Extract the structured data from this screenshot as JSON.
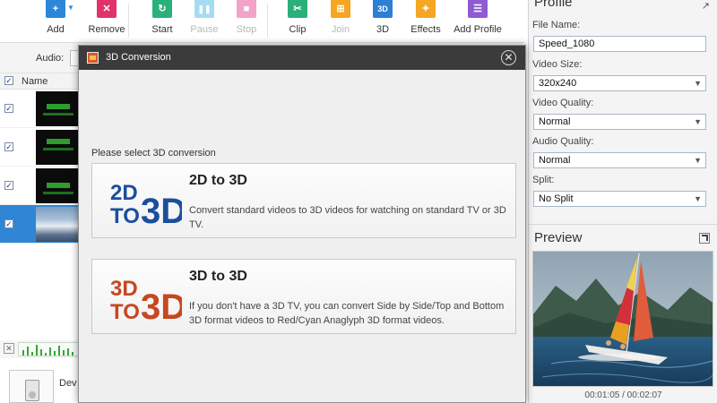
{
  "toolbar": {
    "buttons": [
      {
        "label": "Add",
        "icon": "plus-icon",
        "color": "#2d86d9",
        "enabled": true
      },
      {
        "label": "Remove",
        "icon": "close-icon",
        "color": "#e2326a",
        "enabled": true
      },
      {
        "label": "Start",
        "icon": "refresh-icon",
        "color": "#2bb07a",
        "enabled": true
      },
      {
        "label": "Pause",
        "icon": "pause-icon",
        "color": "#a6dcf2",
        "enabled": false
      },
      {
        "label": "Stop",
        "icon": "stop-icon",
        "color": "#f4a3c8",
        "enabled": false
      },
      {
        "label": "Clip",
        "icon": "scissors-icon",
        "color": "#2bb07a",
        "enabled": true
      },
      {
        "label": "Join",
        "icon": "join-icon",
        "color": "#f5a623",
        "enabled": false
      },
      {
        "label": "3D",
        "icon": "3d-icon",
        "color": "#2d7fd6",
        "enabled": true
      },
      {
        "label": "Effects",
        "icon": "wand-icon",
        "color": "#f5a623",
        "enabled": true
      },
      {
        "label": "Add Profile",
        "icon": "profile-icon",
        "color": "#8e5bd1",
        "enabled": true
      }
    ],
    "icon_glyphs": {
      "plus": "+",
      "close": "✕",
      "refresh": "↻",
      "pause": "❚❚",
      "stop": "■",
      "scissors": "✂",
      "join": "⊞",
      "threed": "3D",
      "wand": "✦",
      "profile": "☰"
    }
  },
  "left_pane": {
    "audio_label": "Audio:",
    "column_name": "Name",
    "check_mark": "✓",
    "selected_row": 3,
    "device_label": "Dev"
  },
  "profile": {
    "title": "Profile",
    "corner_icon": "↗",
    "file_name_label": "File Name:",
    "file_name_value": "Speed_1080",
    "video_size_label": "Video Size:",
    "video_size_value": "320x240",
    "video_quality_label": "Video Quality:",
    "video_quality_value": "Normal",
    "audio_quality_label": "Audio Quality:",
    "audio_quality_value": "Normal",
    "split_label": "Split:",
    "split_value": "No Split",
    "dropdown_arrow": "▼"
  },
  "preview": {
    "title": "Preview",
    "time": "00:01:05 / 00:02:07"
  },
  "dialog": {
    "title": "3D Conversion",
    "close_glyph": "✕",
    "prompt": "Please select 3D conversion",
    "options": [
      {
        "title": "2D to 3D",
        "logo_top": "2D",
        "logo_bottom": "TO",
        "logo_big": "3D",
        "logo_color": "#1b4f9c",
        "description": "Convert standard videos to 3D videos for watching on standard TV or 3D TV."
      },
      {
        "title": "3D to 3D",
        "logo_top": "3D",
        "logo_bottom": "TO",
        "logo_big": "3D",
        "logo_color": "#c8471f",
        "description": "If you don't have a 3D TV, you can convert Side by Side/Top and Bottom 3D format videos to Red/Cyan Anaglyph 3D format videos."
      }
    ]
  }
}
